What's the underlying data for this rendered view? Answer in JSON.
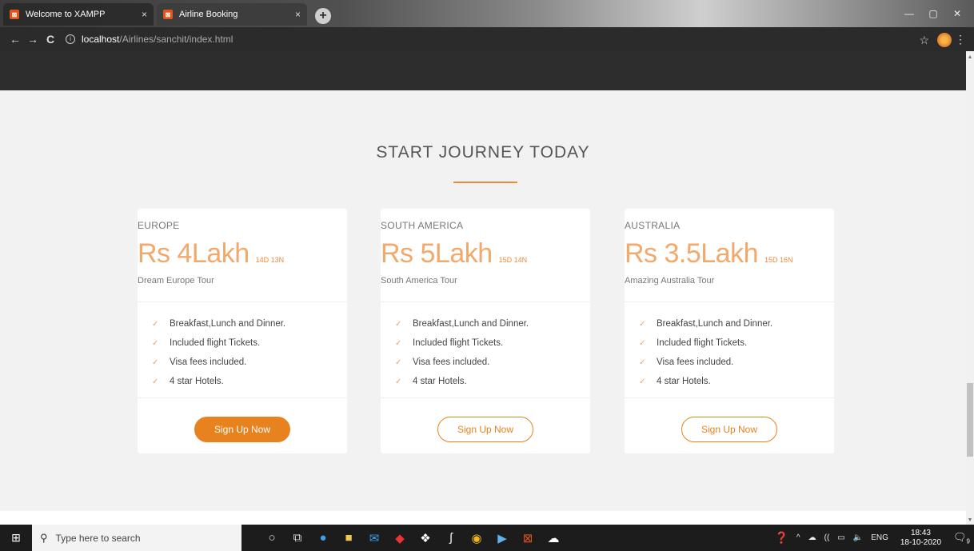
{
  "browser": {
    "tabs": [
      {
        "label": "Welcome to XAMPP",
        "icon": "xampp-favicon"
      },
      {
        "label": "Airline Booking",
        "icon": "xampp-favicon"
      }
    ],
    "url_host": "localhost",
    "url_path": "/Airlines/sanchit/index.html",
    "new_tab_glyph": "+",
    "close_glyph": "×",
    "back_glyph": "←",
    "forward_glyph": "→",
    "reload_glyph": "C",
    "star_glyph": "☆",
    "menu_glyph": "⋮"
  },
  "section": {
    "title": "START JOURNEY TODAY",
    "accent_color": "#ea8b3a"
  },
  "plans": [
    {
      "region": "EUROPE",
      "price": "Rs 4Lakh",
      "duration": "14D 13N",
      "tour": "Dream Europe Tour",
      "features": [
        "Breakfast,Lunch and Dinner.",
        "Included flight Tickets.",
        "Visa fees included.",
        "4 star Hotels."
      ],
      "button": "Sign Up Now",
      "button_style": "filled"
    },
    {
      "region": "SOUTH AMERICA",
      "price": "Rs 5Lakh",
      "duration": "15D 14N",
      "tour": "South America Tour",
      "features": [
        "Breakfast,Lunch and Dinner.",
        "Included flight Tickets.",
        "Visa fees included.",
        "4 star Hotels."
      ],
      "button": "Sign Up Now",
      "button_style": "outline"
    },
    {
      "region": "AUSTRALIA",
      "price": "Rs 3.5Lakh",
      "duration": "15D 16N",
      "tour": "Amazing Australia Tour",
      "features": [
        "Breakfast,Lunch and Dinner.",
        "Included flight Tickets.",
        "Visa fees included.",
        "4 star Hotels."
      ],
      "button": "Sign Up Now",
      "button_style": "outline"
    }
  ],
  "taskbar": {
    "search_placeholder": "Type here to search",
    "language": "ENG",
    "time": "18:43",
    "date": "18-10-2020",
    "notification_count": "9",
    "pinned_icons": [
      "cortana-icon",
      "task-view-icon",
      "edge-icon",
      "file-explorer-icon",
      "mail-icon",
      "app-icon",
      "dropbox-icon",
      "sublime-icon",
      "chrome-icon",
      "terminal-icon",
      "xampp-icon",
      "photos-icon"
    ]
  },
  "colors": {
    "price": "#f3a96b",
    "button": "#e8821f",
    "check": "#f0a060"
  }
}
